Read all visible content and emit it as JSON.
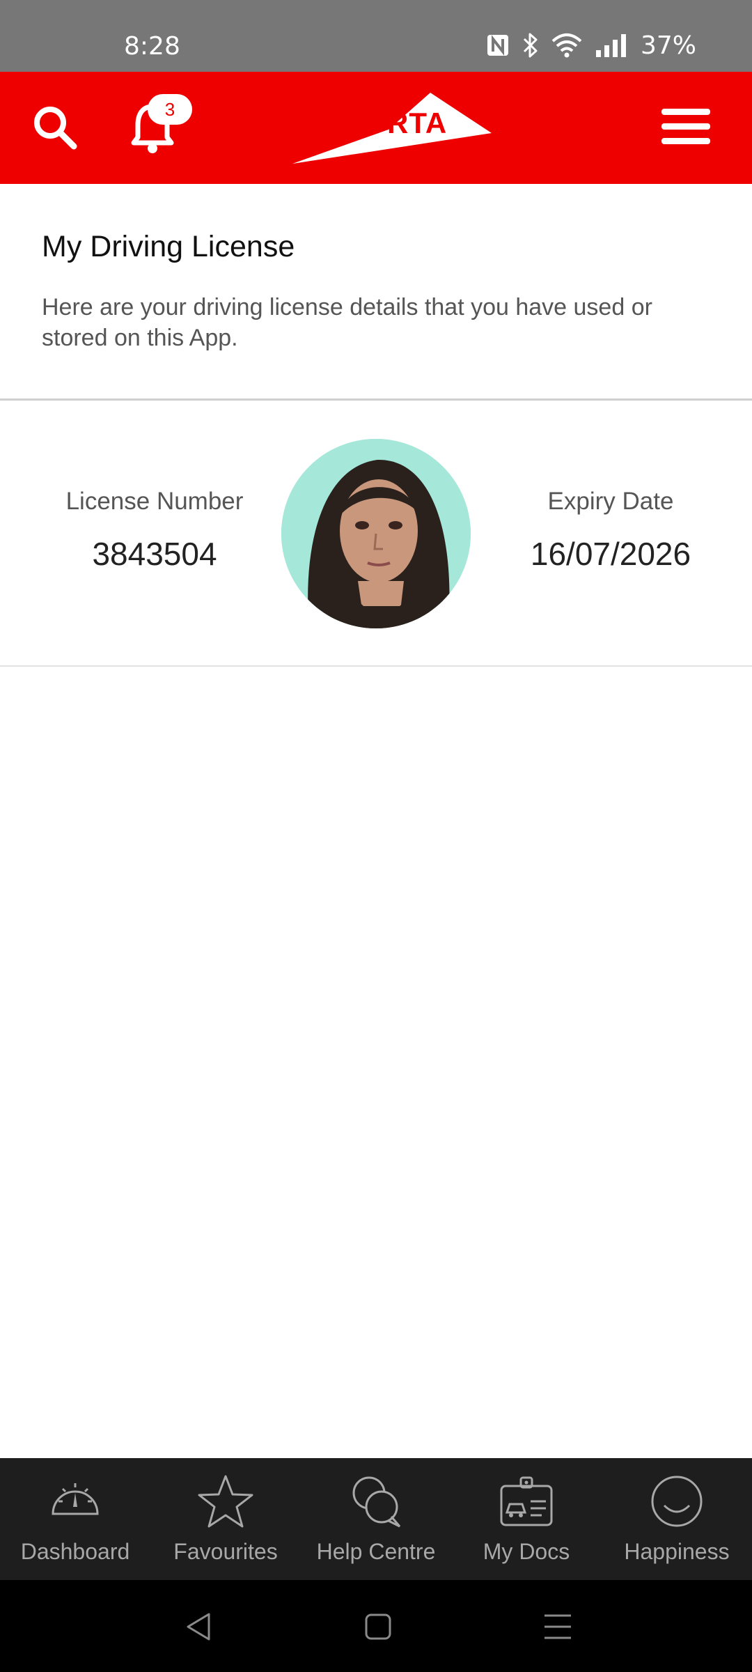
{
  "status_bar": {
    "time": "8:28",
    "battery": "37%",
    "icons": [
      "nfc-icon",
      "bluetooth-icon",
      "wifi-icon",
      "signal-icon"
    ]
  },
  "header": {
    "logo_text": "RTA",
    "notification_count": "3",
    "brand_color": "#ee0000",
    "icons": [
      "search-icon",
      "bell-icon",
      "menu-icon"
    ]
  },
  "intro": {
    "title": "My Driving License",
    "description": "Here are your driving license details that you have used or stored on this App."
  },
  "license": {
    "number_label": "License Number",
    "number_value": "3843504",
    "expiry_label": "Expiry Date",
    "expiry_value": "16/07/2026"
  },
  "bottom_nav": {
    "items": [
      {
        "label": "Dashboard",
        "icon": "speedometer-icon"
      },
      {
        "label": "Favourites",
        "icon": "star-icon"
      },
      {
        "label": "Help Centre",
        "icon": "chat-bubbles-icon"
      },
      {
        "label": "My Docs",
        "icon": "id-card-icon"
      },
      {
        "label": "Happiness",
        "icon": "smiley-icon"
      }
    ]
  },
  "system_nav": {
    "icons": [
      "back-icon",
      "home-icon",
      "recents-icon"
    ]
  }
}
